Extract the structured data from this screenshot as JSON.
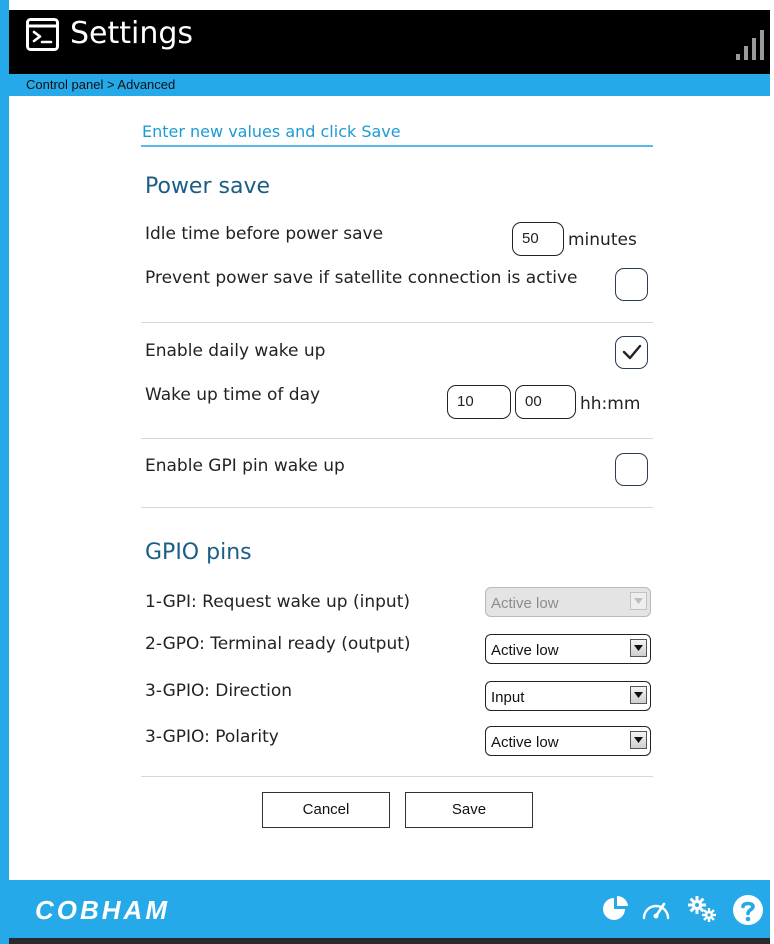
{
  "header": {
    "title": "Settings",
    "app_icon": "terminal-icon",
    "status_icon": "signal-strength-icon"
  },
  "breadcrumb": "Control panel > Advanced",
  "instruction": "Enter new values and click Save",
  "power_save": {
    "title": "Power save",
    "idle_label": "Idle time before power save",
    "idle_value": "50",
    "idle_unit": "minutes",
    "prevent_label": "Prevent power save if satellite connection is active",
    "prevent_checked": false,
    "daily_wake_label": "Enable daily wake up",
    "daily_wake_checked": true,
    "wake_time_label": "Wake up time of day",
    "wake_hour": "10",
    "wake_minute": "00",
    "wake_unit": "hh:mm",
    "gpi_wake_label": "Enable GPI pin wake up",
    "gpi_wake_checked": false
  },
  "gpio": {
    "title": "GPIO pins",
    "rows": [
      {
        "label": "1-GPI: Request wake up (input)",
        "value": "Active low",
        "disabled": true
      },
      {
        "label": "2-GPO: Terminal ready (output)",
        "value": "Active low",
        "disabled": false
      },
      {
        "label": "3-GPIO: Direction",
        "value": "Input",
        "disabled": false
      },
      {
        "label": "3-GPIO: Polarity",
        "value": "Active low",
        "disabled": false
      }
    ]
  },
  "buttons": {
    "cancel": "Cancel",
    "save": "Save"
  },
  "footer": {
    "logo": "COBHAM",
    "icons": [
      "pie-chart-icon",
      "gauge-icon",
      "settings-icon",
      "help-icon"
    ]
  },
  "colors": {
    "accent": "#26a9e8",
    "header_bg": "#000000",
    "section_title": "#1a5e87",
    "instruction": "#1e9ad6"
  }
}
